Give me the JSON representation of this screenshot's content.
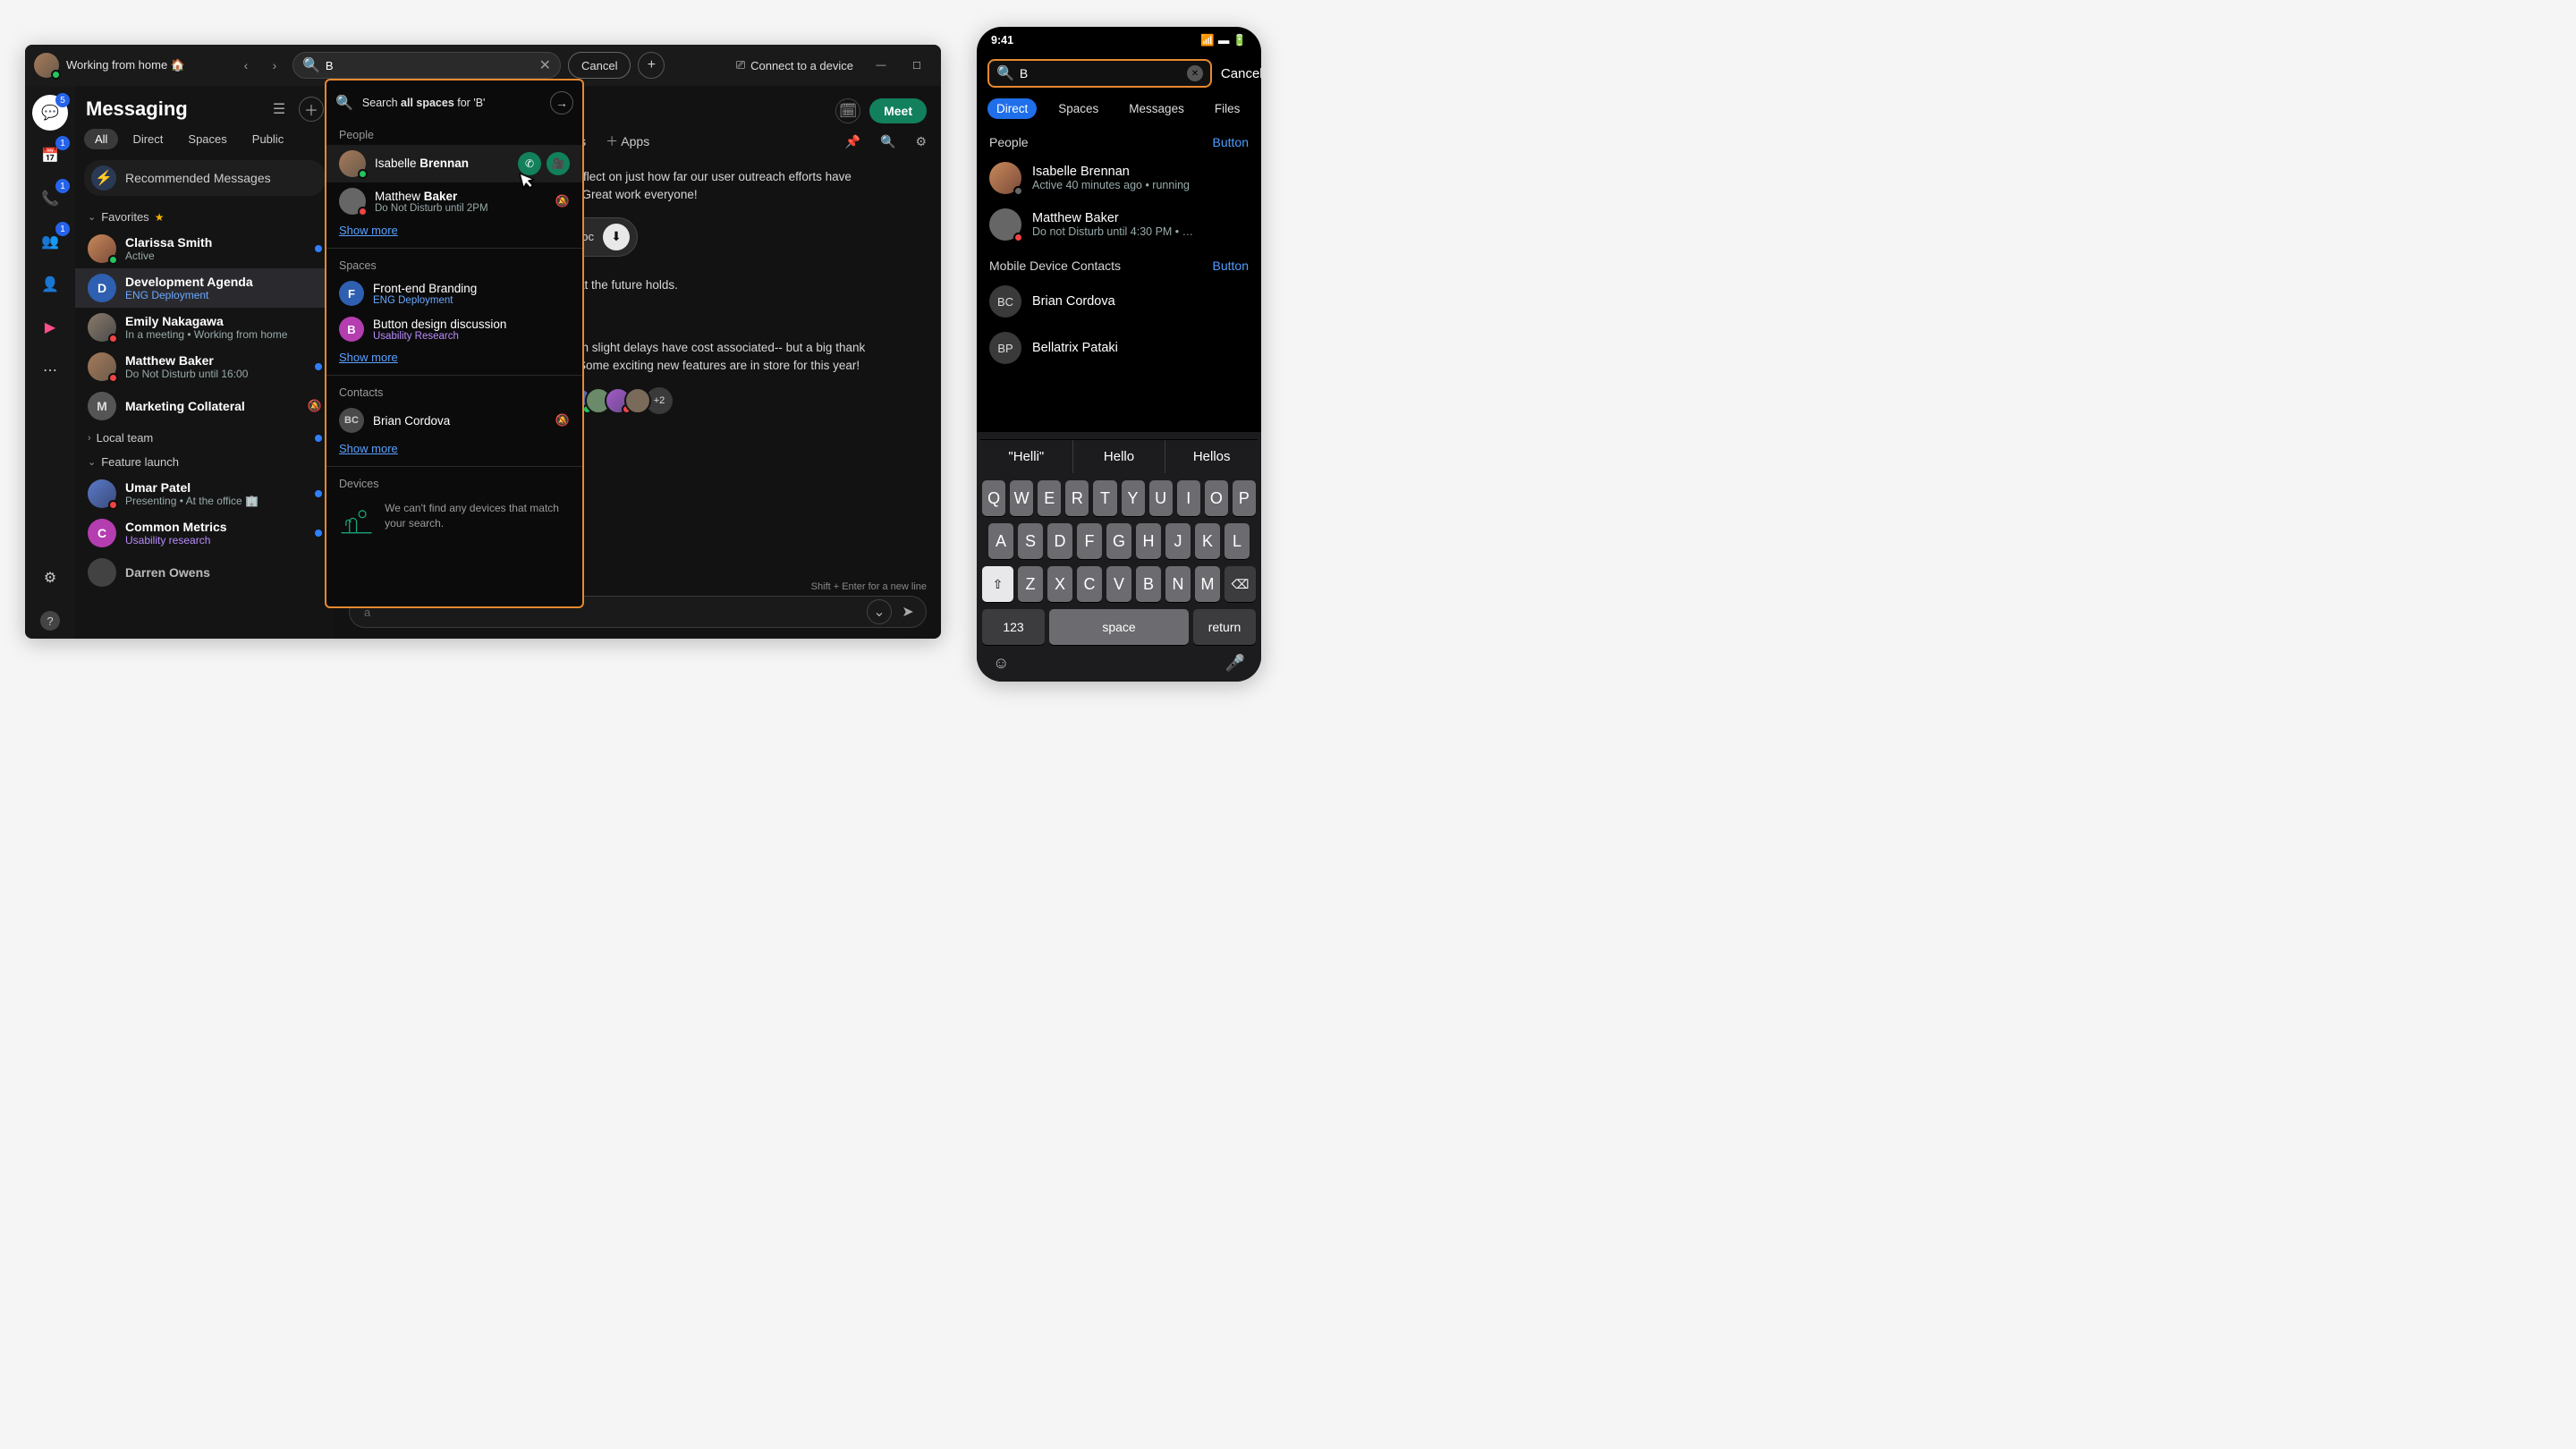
{
  "desktop": {
    "status": "Working from home 🏠",
    "nav_back": "‹",
    "nav_fwd": "›",
    "search_value": "B",
    "clear": "✕",
    "cancel": "Cancel",
    "plus": "+",
    "connect": "Connect to a device",
    "win_min": "—",
    "win_max": "☐",
    "rail_badges": {
      "messaging": "5",
      "calendar": "1",
      "calls": "1",
      "teams": "1"
    }
  },
  "sidebar": {
    "title": "Messaging",
    "tabs": [
      "All",
      "Direct",
      "Spaces",
      "Public"
    ],
    "active_tab": 0,
    "recommended": "Recommended Messages",
    "groups": {
      "favorites": "Favorites",
      "local": "Local team",
      "launch": "Feature launch"
    },
    "entries": [
      {
        "name": "Clarissa Smith",
        "sub": "Active",
        "presence": "green",
        "unread": true,
        "avatar": "brown"
      },
      {
        "name": "Development Agenda",
        "sub": "ENG Deployment",
        "subclass": "blue",
        "initial": "D",
        "initbg": "#2f5fb0",
        "selected": true
      },
      {
        "name": "Emily Nakagawa",
        "sub": "In a meeting  •  Working from home",
        "presence": "red",
        "avatar": "gray"
      },
      {
        "name": "Matthew Baker",
        "sub": "Do Not Disturb until 16:00",
        "presence": "red",
        "unread": true,
        "avatar": "brown"
      },
      {
        "name": "Marketing Collateral",
        "sub": "",
        "initial": "M",
        "initbg": "#555",
        "notif_off": true
      },
      {
        "name": "Umar Patel",
        "sub": "Presenting   •   At the office 🏢",
        "presence": "red",
        "unread": true,
        "avatar": "blue"
      },
      {
        "name": "Common Metrics",
        "sub": "Usability research",
        "subclass": "purple",
        "initial": "C",
        "initbg": "#b43db0",
        "unread": true
      },
      {
        "name": "Darren Owens",
        "sub": "",
        "avatar": "gray"
      }
    ]
  },
  "content": {
    "meet": "Meet",
    "tabs": {
      "meetings": "eetings",
      "apps": "Apps"
    },
    "msg1": "nt to reflect on just how far our user outreach efforts have",
    "msg1b": "alone. Great work everyone!",
    "file": "ap.doc",
    "msg2": "ee what the future holds.",
    "msg3": "nd even slight delays have cost associated-- but a big thank",
    "msg3b": "work! Some exciting new features are in store for this year!",
    "plus_avatars": "+2",
    "hint": "Shift + Enter for a new line",
    "placeholder": "a"
  },
  "dropdown": {
    "topline_pre": "Search ",
    "topline_bold": "all spaces",
    "topline_post": " for 'B'",
    "sections": {
      "people": "People",
      "spaces": "Spaces",
      "contacts": "Contacts",
      "devices": "Devices"
    },
    "people": [
      {
        "pre": "Isabelle ",
        "match": "Brennan",
        "sub": "",
        "presence": "green",
        "avatar": "brown",
        "actions": true
      },
      {
        "pre": "Matthew ",
        "match": "Baker",
        "sub": "Do Not Disturb until 2PM",
        "presence": "red",
        "avatar": "gray",
        "notif_off": true
      }
    ],
    "spaces": [
      {
        "name": "Front-end Branding",
        "sub": "ENG Deployment",
        "subclass": "blue",
        "initial": "F",
        "initbg": "#2f5fb0"
      },
      {
        "name": "Button design discussion",
        "sub": "Usability Research",
        "subclass": "purple",
        "initial": "B",
        "initbg": "#b43db0"
      }
    ],
    "contacts": [
      {
        "name": "Brian Cordova",
        "initial": "BC",
        "notif_off": true
      }
    ],
    "show_more": "Show more",
    "empty": "We can't find any devices that match your search."
  },
  "mobile": {
    "time": "9:41",
    "search_value": "B",
    "cancel": "Cancel",
    "tabs": [
      "Direct",
      "Spaces",
      "Messages",
      "Files"
    ],
    "active_tab": 0,
    "sections": {
      "people": "People",
      "contacts": "Mobile Device Contacts",
      "button": "Button"
    },
    "people": [
      {
        "name": "Isabelle Brennan",
        "sub": "Active 40 minutes ago • running",
        "presence": "gray",
        "avatar": "brown"
      },
      {
        "name": "Matthew Baker",
        "sub": "Do not Disturb until 4:30 PM • …",
        "presence": "red",
        "avatar": "gray"
      }
    ],
    "contacts": [
      {
        "initial": "BC",
        "name": "Brian Cordova"
      },
      {
        "initial": "BP",
        "name": "Bellatrix Pataki"
      }
    ],
    "suggestions": [
      "\"Helli\"",
      "Hello",
      "Hellos"
    ],
    "keys_r1": [
      "Q",
      "W",
      "E",
      "R",
      "T",
      "Y",
      "U",
      "I",
      "O",
      "P"
    ],
    "keys_r2": [
      "A",
      "S",
      "D",
      "F",
      "G",
      "H",
      "J",
      "K",
      "L"
    ],
    "keys_r3": [
      "Z",
      "X",
      "C",
      "V",
      "B",
      "N",
      "M"
    ],
    "num": "123",
    "space": "space",
    "ret": "return"
  }
}
